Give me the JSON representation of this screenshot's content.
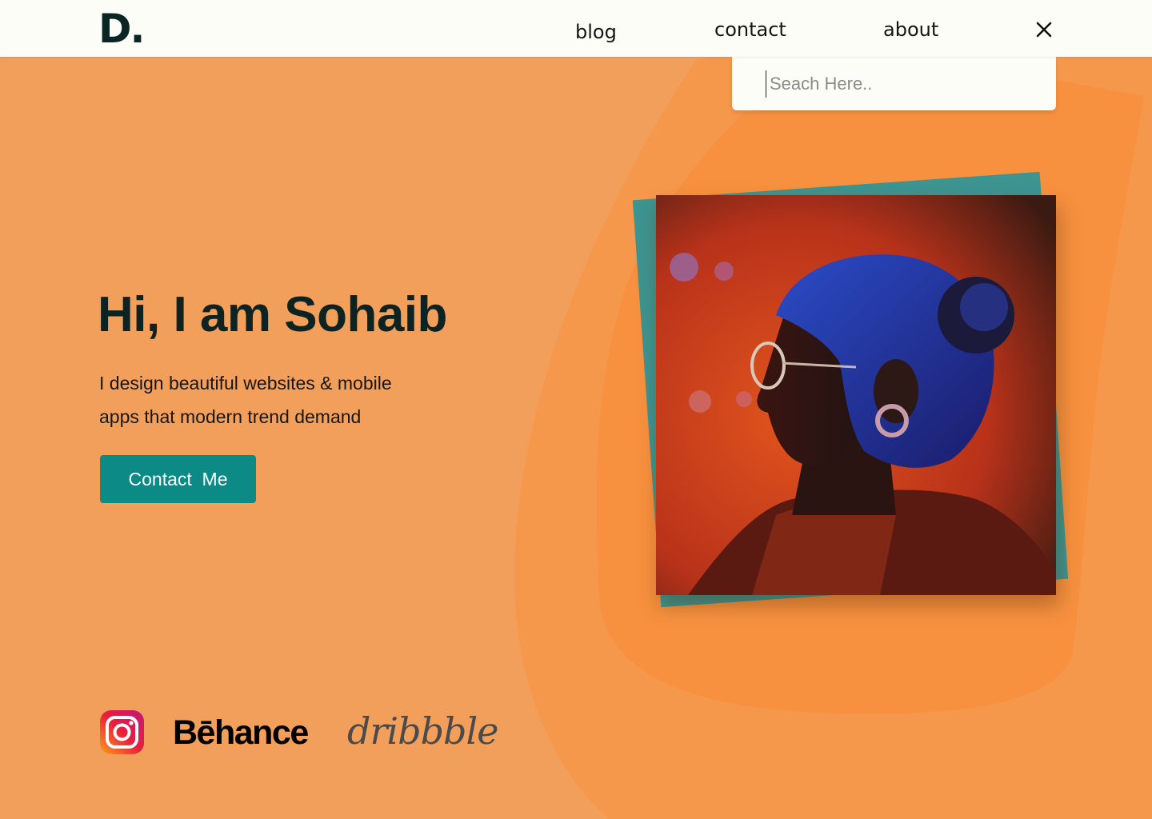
{
  "logo": {
    "text": "D"
  },
  "nav": {
    "items": [
      {
        "label": "blog"
      },
      {
        "label": "contact"
      },
      {
        "label": "about"
      }
    ],
    "close_icon": "close-icon"
  },
  "search": {
    "placeholder": "Seach Here..",
    "value": ""
  },
  "hero": {
    "title": "Hi, I am Sohaib",
    "subtitle": "I design beautiful websites & mobile apps that modern trend demand",
    "button_label": "Contact  Me"
  },
  "social": {
    "instagram_icon": "instagram-icon",
    "behance": "Bēhance",
    "dribbble": "dribbble"
  },
  "colors": {
    "background": "#f39f5c",
    "blob": "#f7913f",
    "accent": "#0b8a86",
    "photo_back": "#3d9490",
    "heading": "#0c2322"
  }
}
